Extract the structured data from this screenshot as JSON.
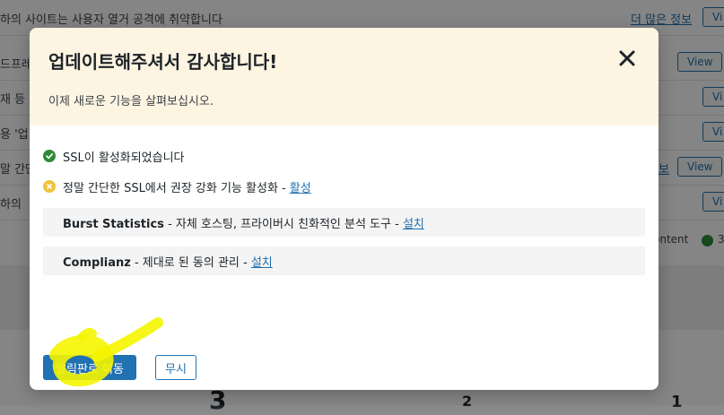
{
  "background": {
    "rows": [
      {
        "text": "하의 사이트는 사용자 열거 공격에 취약합니다",
        "link": "더 많은 정보",
        "button": "Vi"
      },
      {
        "text": "드프레",
        "link": "",
        "button": "View"
      },
      {
        "text": "재 등",
        "link": "",
        "button": "Vi"
      },
      {
        "text": "용 '업",
        "link": "",
        "button": "Vi"
      },
      {
        "text": "말 간단",
        "link": "보",
        "button": "View"
      },
      {
        "text": "하의 ",
        "link": "",
        "button": "Vi"
      }
    ],
    "content_label": "ontent",
    "content_count": "3",
    "stats": [
      "3",
      "2",
      "1"
    ]
  },
  "modal": {
    "title": "업데이트해주셔서 감사합니다!",
    "subtitle": "이제 새로운 기능을 살펴보십시오.",
    "status_ok": "SSL이 활성화되었습니다",
    "status_warn": "정말 간단한 SSL에서 권장 강화 기능 활성화 -",
    "status_warn_link": "활성",
    "plugins": [
      {
        "name": "Burst Statistics",
        "desc": " - 자체 호스팅, 프라이버시 친화적인 분석 도구 - ",
        "action": "설치"
      },
      {
        "name": "Complianz",
        "desc": " - 제대로 된 동의 관리 - ",
        "action": "설치"
      }
    ],
    "primary_button": "알림판로 이동",
    "secondary_button": "무시"
  },
  "colors": {
    "accent": "#2271b1",
    "header_bg": "#fdf4e2",
    "ok": "#2e8a37",
    "warn": "#f0c33c",
    "scribble": "#f5f500"
  },
  "icons": [
    "close-icon",
    "check-circle-icon",
    "warning-circle-icon"
  ]
}
